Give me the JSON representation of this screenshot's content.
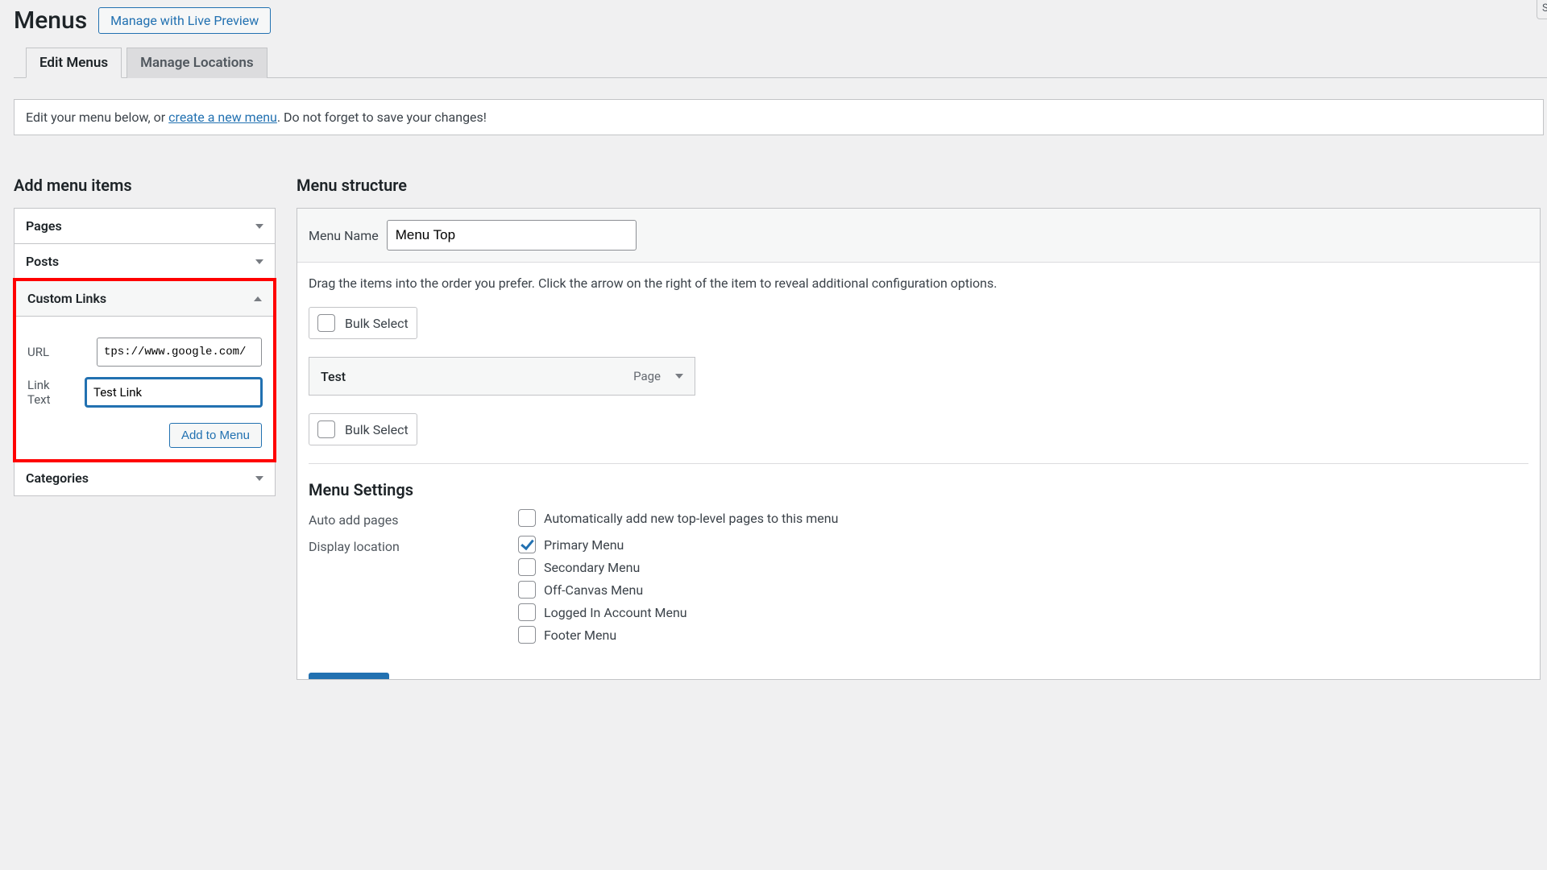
{
  "header": {
    "page_title": "Menus",
    "live_preview_btn": "Manage with Live Preview",
    "screen_options_initial": "S"
  },
  "tabs": {
    "edit": "Edit Menus",
    "locations": "Manage Locations"
  },
  "manage_bar": {
    "prefix": "Edit your menu below, or ",
    "link": "create a new menu",
    "suffix": ". Do not forget to save your changes!"
  },
  "left": {
    "title": "Add menu items",
    "panels": {
      "pages": "Pages",
      "posts": "Posts",
      "custom": "Custom Links",
      "categories": "Categories"
    },
    "custom_links": {
      "url_label": "URL",
      "url_value": "tps://www.google.com/",
      "text_label": "Link Text",
      "text_value": "Test Link",
      "add_btn": "Add to Menu"
    }
  },
  "right": {
    "title": "Menu structure",
    "menu_name_label": "Menu Name",
    "menu_name_value": "Menu Top",
    "drag_info": "Drag the items into the order you prefer. Click the arrow on the right of the item to reveal additional configuration options.",
    "bulk_select": "Bulk Select",
    "items": [
      {
        "title": "Test",
        "type": "Page"
      }
    ],
    "settings_title": "Menu Settings",
    "auto_add_label": "Auto add pages",
    "auto_add_option": "Automatically add new top-level pages to this menu",
    "display_loc_label": "Display location",
    "locations": [
      {
        "name": "Primary Menu",
        "checked": true
      },
      {
        "name": "Secondary Menu",
        "checked": false
      },
      {
        "name": "Off-Canvas Menu",
        "checked": false
      },
      {
        "name": "Logged In Account Menu",
        "checked": false
      },
      {
        "name": "Footer Menu",
        "checked": false
      }
    ]
  }
}
